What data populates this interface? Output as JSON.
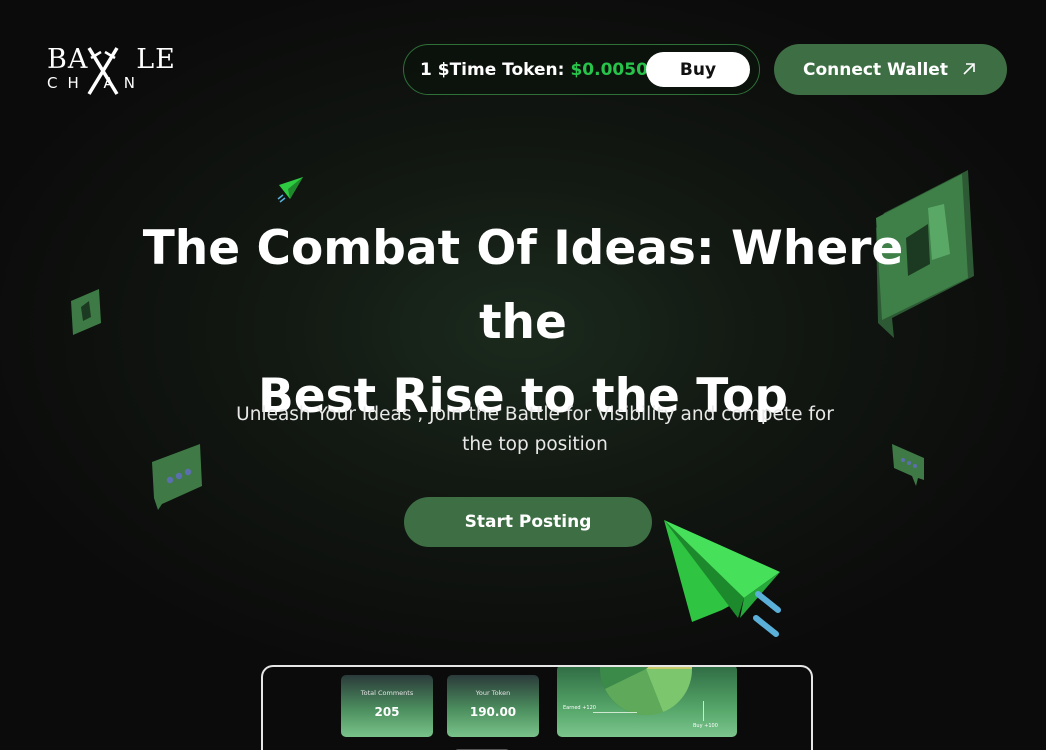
{
  "brand": {
    "logo_top": "BATTLE",
    "logo_bottom": "CHAN"
  },
  "header": {
    "token_label": "1 $Time Token:",
    "token_price": "$0.0050",
    "buy_label": "Buy",
    "connect_label": "Connect Wallet"
  },
  "hero": {
    "title_line1": "The Combat Of Ideas: Where the",
    "title_line2": "Best Rise to the Top",
    "subtitle_line1": "Unleash Your Ideas , Join the Battle for Visibility and compete for",
    "subtitle_line2": "the top position",
    "cta_label": "Start Posting"
  },
  "preview": {
    "cards": [
      {
        "label": "Total Comments",
        "value": "205"
      },
      {
        "label": "Your Token",
        "value": "190.00"
      }
    ],
    "chart_labels": {
      "earned": "Earned +120",
      "buy": "Buy +100"
    }
  },
  "colors": {
    "accent_green": "#3e6e44",
    "price_green": "#27c34a",
    "background": "#0c0c0c"
  },
  "icons": [
    "swords-icon",
    "arrow-up-right-icon",
    "paper-plane-icon",
    "thumbs-up-bubble-icon",
    "chat-bubble-icon"
  ]
}
